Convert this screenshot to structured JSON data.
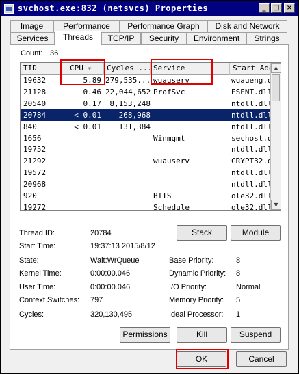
{
  "window": {
    "title": "svchost.exe:832 (netsvcs) Properties"
  },
  "tabs_back": [
    {
      "label": "Image"
    },
    {
      "label": "Performance"
    },
    {
      "label": "Performance Graph"
    },
    {
      "label": "Disk and Network"
    }
  ],
  "tabs_front": [
    {
      "label": "Services"
    },
    {
      "label": "Threads"
    },
    {
      "label": "TCP/IP"
    },
    {
      "label": "Security"
    },
    {
      "label": "Environment"
    },
    {
      "label": "Strings"
    }
  ],
  "count": {
    "label": "Count:",
    "value": "36"
  },
  "columns": [
    "TID",
    "CPU",
    "Cycles ...",
    "Service",
    "Start Add"
  ],
  "rows": [
    {
      "tid": "19632",
      "cpu": "5.89",
      "cycles": "279,535...",
      "service": "wuauserv",
      "start": "wuaueng.dl"
    },
    {
      "tid": "21128",
      "cpu": "0.46",
      "cycles": "22,044,652",
      "service": "ProfSvc",
      "start": "ESENT.dll!"
    },
    {
      "tid": "20540",
      "cpu": "0.17",
      "cycles": "8,153,248",
      "service": "",
      "start": "ntdll.dll!"
    },
    {
      "tid": "20784",
      "cpu": "< 0.01",
      "cycles": "268,968",
      "service": "",
      "start": "ntdll.dll!"
    },
    {
      "tid": "840",
      "cpu": "< 0.01",
      "cycles": "131,384",
      "service": "",
      "start": "ntdll.dll!"
    },
    {
      "tid": "1656",
      "cpu": "",
      "cycles": "",
      "service": "Winmgmt",
      "start": "sechost.dl"
    },
    {
      "tid": "19752",
      "cpu": "",
      "cycles": "",
      "service": "",
      "start": "ntdll.dll!"
    },
    {
      "tid": "21292",
      "cpu": "",
      "cycles": "",
      "service": "wuauserv",
      "start": "CRYPT32.dl"
    },
    {
      "tid": "19572",
      "cpu": "",
      "cycles": "",
      "service": "",
      "start": "ntdll.dll!"
    },
    {
      "tid": "20968",
      "cpu": "",
      "cycles": "",
      "service": "",
      "start": "ntdll.dll!"
    },
    {
      "tid": "920",
      "cpu": "",
      "cycles": "",
      "service": "BITS",
      "start": "ole32.dll!"
    },
    {
      "tid": "19272",
      "cpu": "",
      "cycles": "",
      "service": "Schedule",
      "start": "ole32.dll!"
    }
  ],
  "details": {
    "thread_id_label": "Thread ID:",
    "thread_id": "20784",
    "start_time_label": "Start Time:",
    "start_time": "19:37:13  2015/8/12",
    "state_label": "State:",
    "state": "Wait:WrQueue",
    "kernel_time_label": "Kernel Time:",
    "kernel_time": "0:00:00.046",
    "user_time_label": "User Time:",
    "user_time": "0:00:00.046",
    "context_switches_label": "Context Switches:",
    "context_switches": "797",
    "cycles_label": "Cycles:",
    "cycles": "320,130,495",
    "base_priority_label": "Base Priority:",
    "base_priority": "8",
    "dynamic_priority_label": "Dynamic Priority:",
    "dynamic_priority": "8",
    "io_priority_label": "I/O Priority:",
    "io_priority": "Normal",
    "memory_priority_label": "Memory Priority:",
    "memory_priority": "5",
    "ideal_processor_label": "Ideal Processor:",
    "ideal_processor": "1"
  },
  "buttons": {
    "stack": "Stack",
    "module": "Module",
    "permissions": "Permissions",
    "kill": "Kill",
    "suspend": "Suspend",
    "ok": "OK",
    "cancel": "Cancel"
  },
  "icons": {
    "sort": "sort-desc-icon",
    "minimize": "minimize-icon",
    "maximize": "maximize-icon",
    "close": "close-icon"
  },
  "colors": {
    "title_bg": "#000080",
    "selected_row": "#0a246a",
    "highlight": "#e00000"
  },
  "selected_row_index": 3
}
